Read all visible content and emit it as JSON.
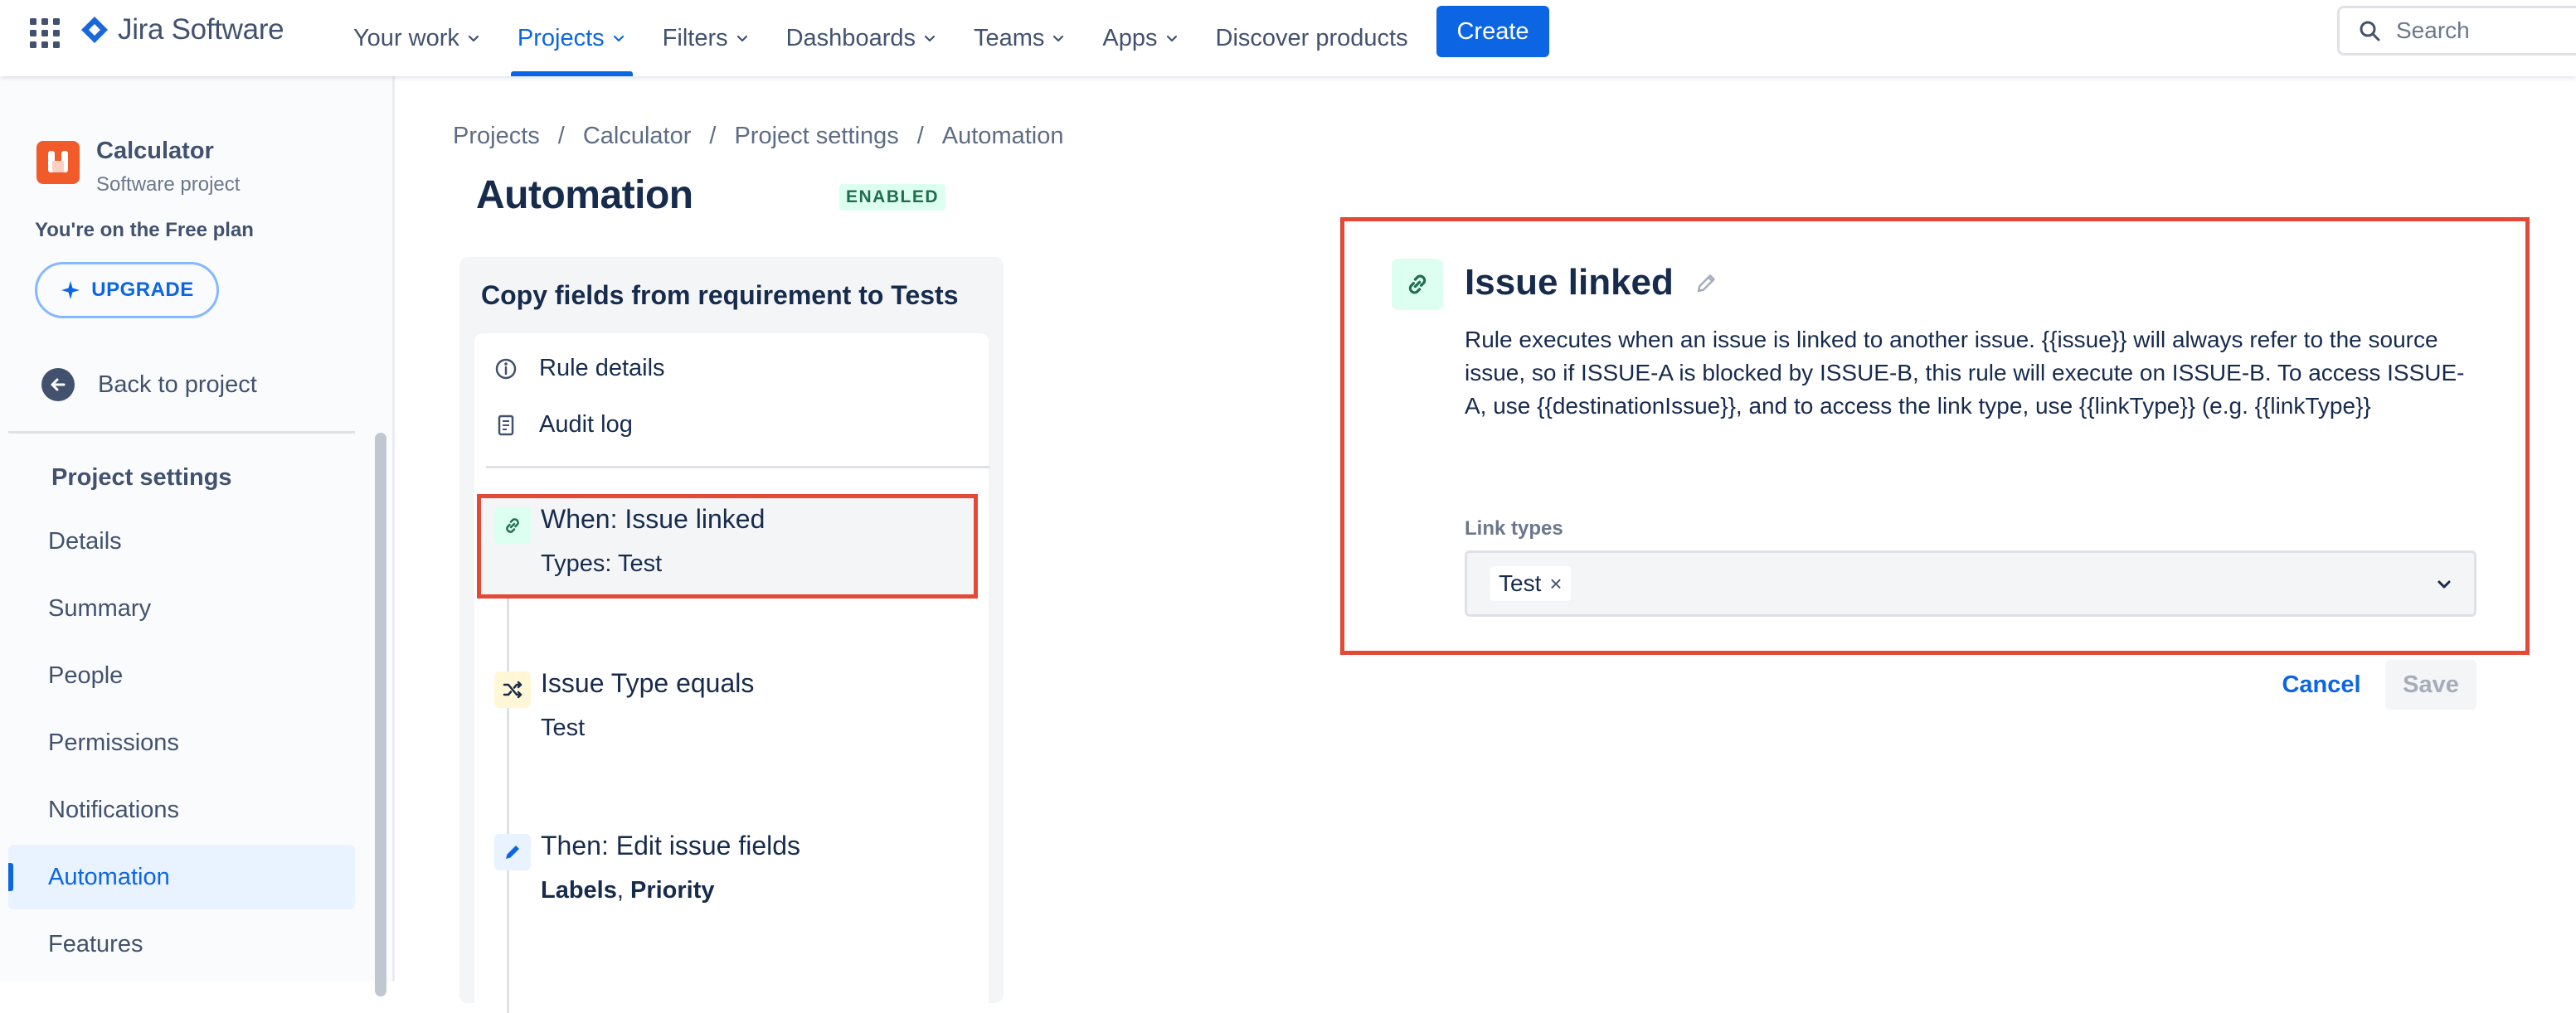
{
  "topnav": {
    "product_name": "Jira Software",
    "items": [
      {
        "label": "Your work",
        "dropdown": true,
        "active": false
      },
      {
        "label": "Projects",
        "dropdown": true,
        "active": true
      },
      {
        "label": "Filters",
        "dropdown": true,
        "active": false
      },
      {
        "label": "Dashboards",
        "dropdown": true,
        "active": false
      },
      {
        "label": "Teams",
        "dropdown": true,
        "active": false
      },
      {
        "label": "Apps",
        "dropdown": true,
        "active": false
      },
      {
        "label": "Discover products",
        "dropdown": false,
        "active": false
      }
    ],
    "create_label": "Create",
    "search_placeholder": "Search",
    "accent_color": "#0C66E4"
  },
  "sidebar": {
    "project_name": "Calculator",
    "project_type": "Software project",
    "plan_text": "You're on the Free plan",
    "upgrade_label": "UPGRADE",
    "back_label": "Back to project",
    "section_heading": "Project settings",
    "items": [
      {
        "label": "Details",
        "active": false
      },
      {
        "label": "Summary",
        "active": false
      },
      {
        "label": "People",
        "active": false
      },
      {
        "label": "Permissions",
        "active": false
      },
      {
        "label": "Notifications",
        "active": false
      },
      {
        "label": "Automation",
        "active": true
      },
      {
        "label": "Features",
        "active": false
      }
    ]
  },
  "breadcrumb": [
    "Projects",
    "Calculator",
    "Project settings",
    "Automation"
  ],
  "breadcrumb_separator": "/",
  "page": {
    "title": "Automation",
    "status_badge": "ENABLED"
  },
  "rule": {
    "name": "Copy fields from requirement to Tests",
    "links": [
      {
        "label": "Rule details",
        "icon": "info-icon"
      },
      {
        "label": "Audit log",
        "icon": "document-icon"
      }
    ],
    "steps": [
      {
        "title": "When: Issue linked",
        "subtitle": "Types: Test",
        "icon": "link-icon",
        "icon_color": "#DCFFF1",
        "selected": true
      },
      {
        "title": "Issue Type equals",
        "subtitle": "Test",
        "icon": "shuffle-icon",
        "icon_color": "#FFF7D6",
        "selected": false
      },
      {
        "title": "Then: Edit issue fields",
        "subtitle_bold_1": "Labels",
        "subtitle_sep": ", ",
        "subtitle_bold_2": "Priority",
        "icon": "pencil-icon",
        "icon_color": "#E9F2FF",
        "selected": false
      }
    ]
  },
  "detail": {
    "title": "Issue linked",
    "description": "Rule executes when an issue is linked to another issue. {{issue}} will always refer to the source issue, so if ISSUE-A is blocked by ISSUE-B, this rule will execute on ISSUE-B. To access ISSUE-A, use {{destinationIssue}}, and to access the link type, use {{linkType}} (e.g. {{linkType}}",
    "link_types_label": "Link types",
    "selected_tags": [
      "Test"
    ],
    "tag_remove_glyph": "×",
    "cancel_label": "Cancel",
    "save_label": "Save"
  },
  "highlight_color": "#E34935"
}
